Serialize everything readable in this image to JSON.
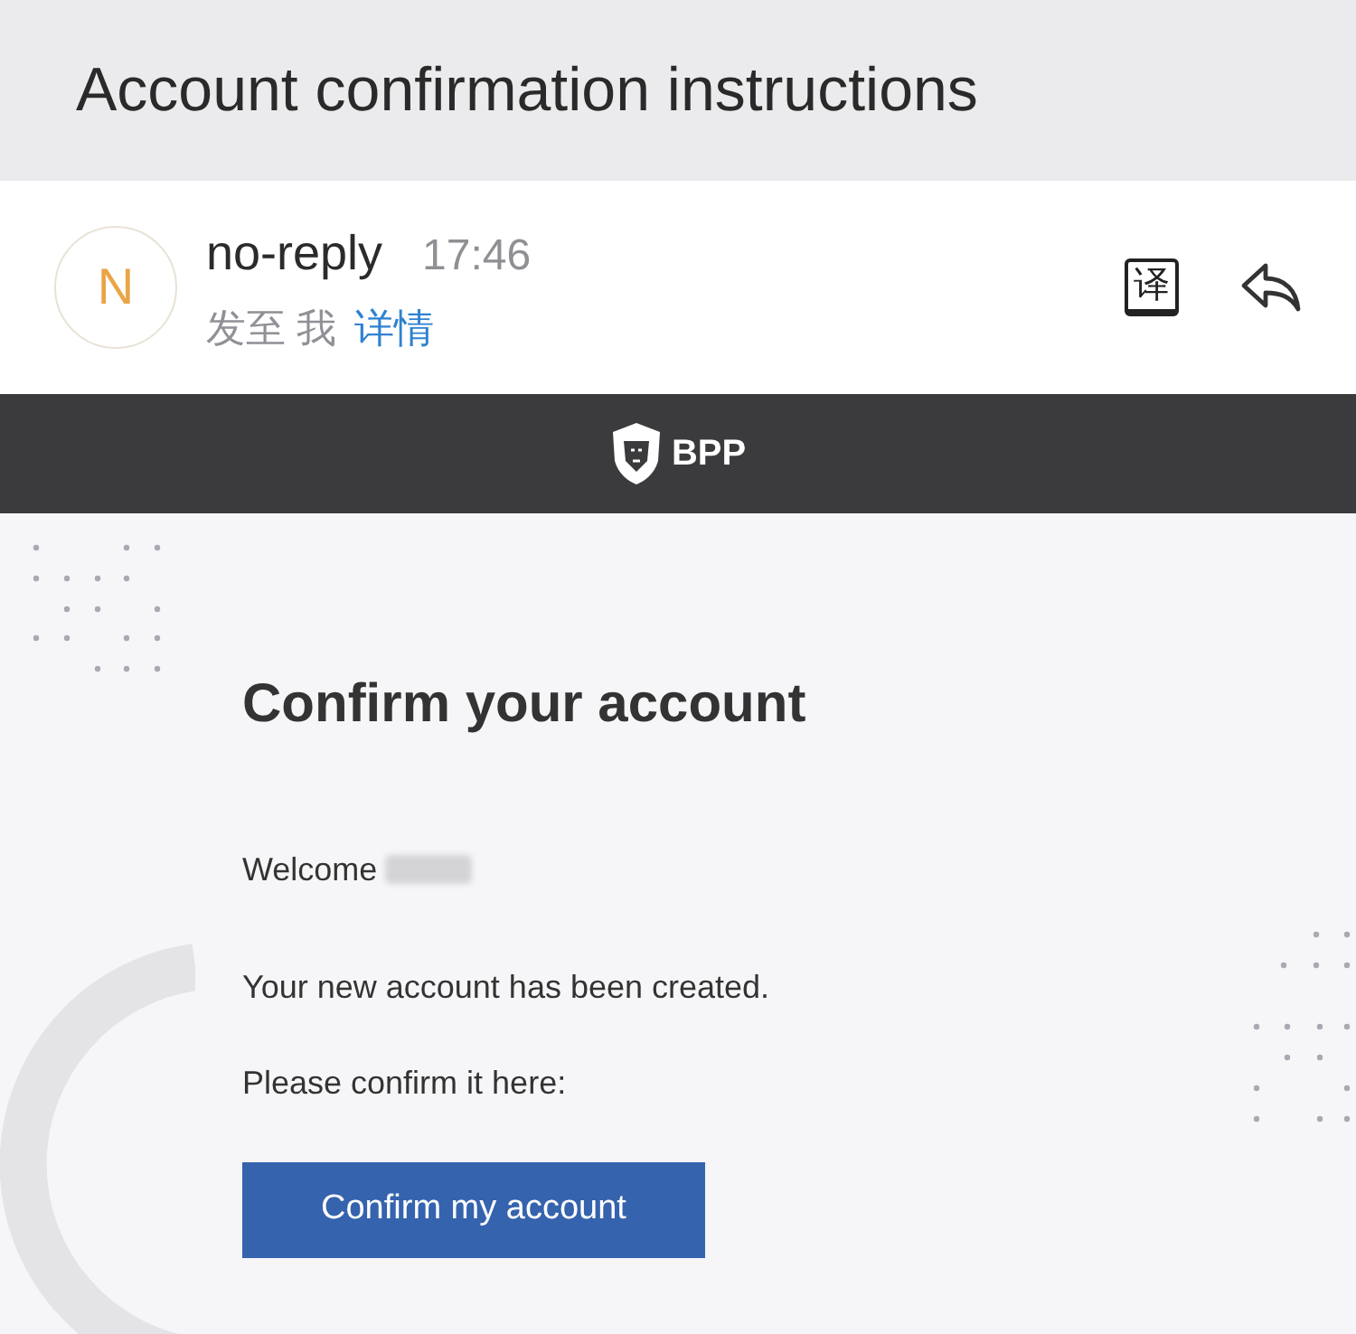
{
  "title": "Account confirmation instructions",
  "sender": {
    "avatar_letter": "N",
    "name": "no-reply",
    "time": "17:46",
    "recipient": "发至 我",
    "details_link": "详情"
  },
  "toolbar": [
    {
      "kind": "translate",
      "label": "译"
    },
    {
      "kind": "reply"
    }
  ],
  "brand": {
    "logo_text": "BPP"
  },
  "email": {
    "heading": "Confirm your account",
    "greeting": "Welcome",
    "name_redacted": true,
    "paragraphs": [
      "Your new account has been created.",
      "Please confirm it here:"
    ],
    "button": "Confirm my account"
  }
}
